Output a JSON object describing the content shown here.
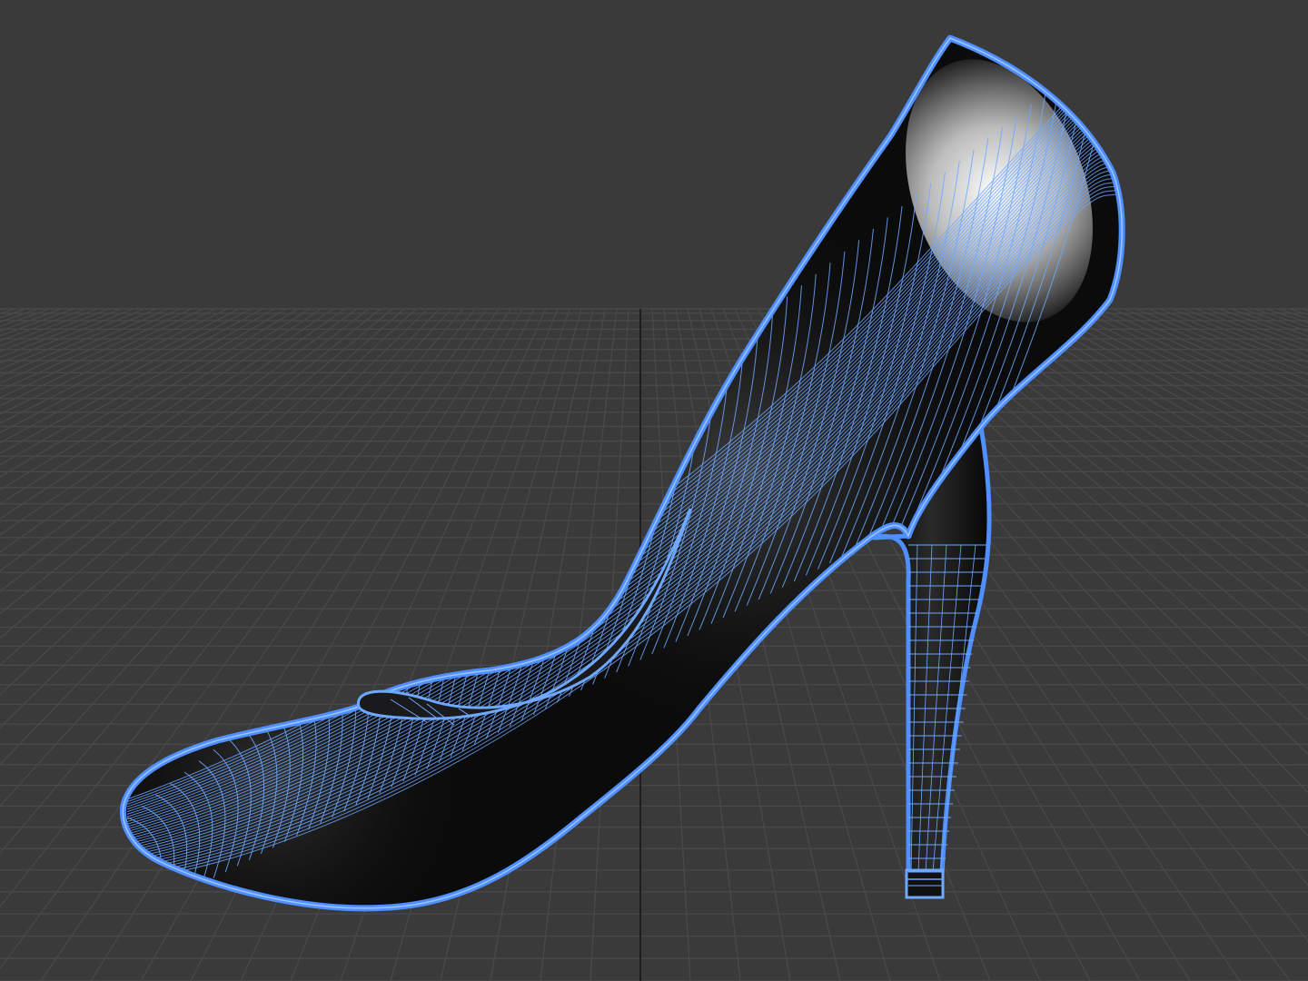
{
  "viewport": {
    "colors": {
      "background": "#3a3a3b",
      "grid_line": "#4a4a4c",
      "grid_axis": "#1e1e1f",
      "wire": "#6ea8ff",
      "wire_outline": "#4f8fff",
      "surface_dark": "#0b0b0c",
      "highlight": "#ffffff"
    },
    "grid_visible": true,
    "display_mode": "shaded-wireframe",
    "object": "high-heel-shoe"
  }
}
